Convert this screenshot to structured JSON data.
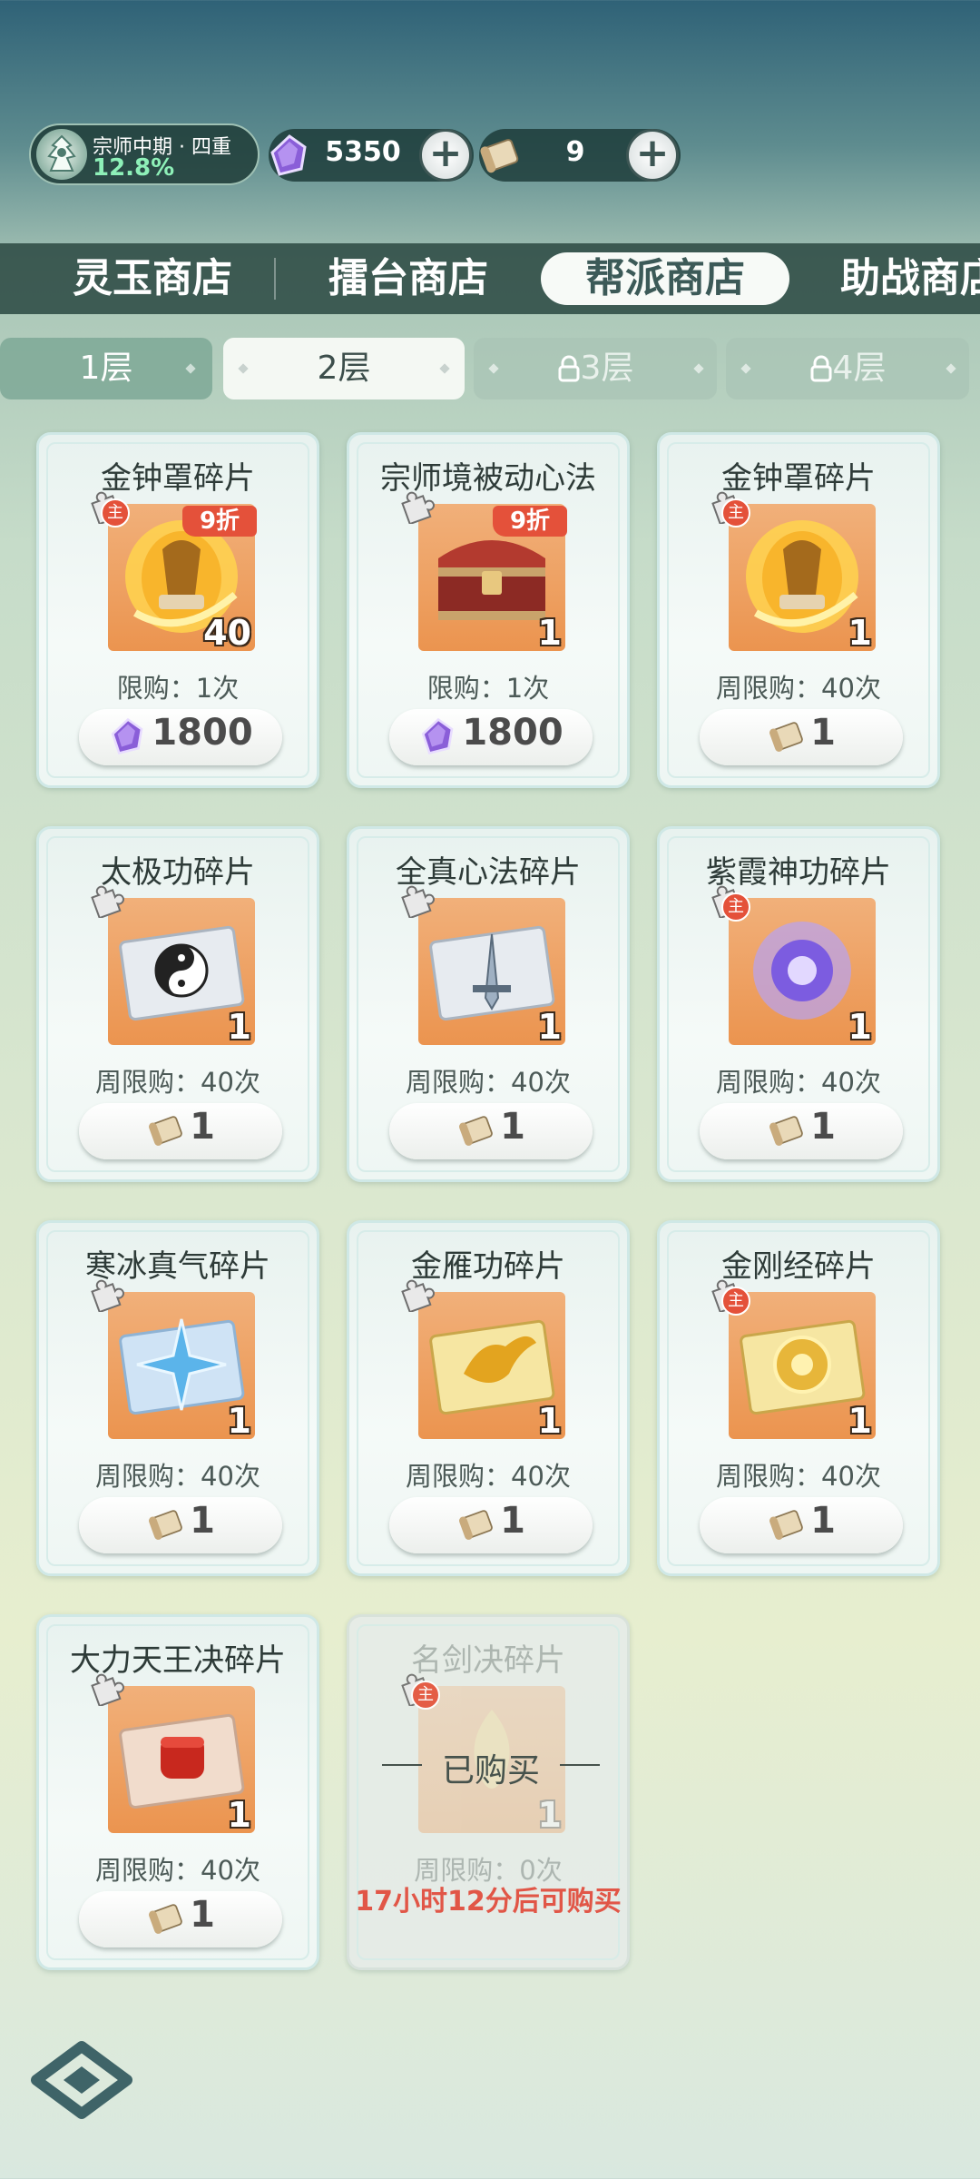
{
  "header": {
    "rank_title": "宗师中期 · 四重",
    "rank_progress": "12.8%",
    "jade_amount": "5350",
    "token_amount": "9",
    "plus_label": "+"
  },
  "shop_tabs": [
    {
      "label": "灵玉商店",
      "active": false
    },
    {
      "label": "擂台商店",
      "active": false
    },
    {
      "label": "帮派商店",
      "active": true
    },
    {
      "label": "助战商店",
      "active": false
    }
  ],
  "floors": [
    {
      "label": "1层",
      "state": "normal"
    },
    {
      "label": "2层",
      "state": "active"
    },
    {
      "label": "3层",
      "state": "locked"
    },
    {
      "label": "4层",
      "state": "locked"
    }
  ],
  "items": [
    {
      "name": "金钟罩碎片",
      "qty": "40",
      "discount": "9折",
      "main": true,
      "limit": "限购：1次",
      "price": "1800",
      "currency": "jade",
      "icon": "golden-bell-icon"
    },
    {
      "name": "宗师境被动心法",
      "qty": "1",
      "discount": "9折",
      "main": false,
      "limit": "限购：1次",
      "price": "1800",
      "currency": "jade",
      "icon": "treasure-chest-icon"
    },
    {
      "name": "金钟罩碎片",
      "qty": "1",
      "discount": "",
      "main": true,
      "limit": "周限购：40次",
      "price": "1",
      "currency": "scroll",
      "icon": "golden-bell-icon"
    },
    {
      "name": "太极功碎片",
      "qty": "1",
      "discount": "",
      "main": false,
      "limit": "周限购：40次",
      "price": "1",
      "currency": "scroll",
      "icon": "taiji-scroll-icon"
    },
    {
      "name": "全真心法碎片",
      "qty": "1",
      "discount": "",
      "main": false,
      "limit": "周限购：40次",
      "price": "1",
      "currency": "scroll",
      "icon": "sword-scroll-icon"
    },
    {
      "name": "紫霞神功碎片",
      "qty": "1",
      "discount": "",
      "main": true,
      "limit": "周限购：40次",
      "price": "1",
      "currency": "scroll",
      "icon": "purple-orb-icon"
    },
    {
      "name": "寒冰真气碎片",
      "qty": "1",
      "discount": "",
      "main": false,
      "limit": "周限购：40次",
      "price": "1",
      "currency": "scroll",
      "icon": "ice-star-scroll-icon"
    },
    {
      "name": "金雁功碎片",
      "qty": "1",
      "discount": "",
      "main": false,
      "limit": "周限购：40次",
      "price": "1",
      "currency": "scroll",
      "icon": "golden-bird-scroll-icon"
    },
    {
      "name": "金刚经碎片",
      "qty": "1",
      "discount": "",
      "main": true,
      "limit": "周限购：40次",
      "price": "1",
      "currency": "scroll",
      "icon": "golden-emblem-scroll-icon"
    },
    {
      "name": "大力天王决碎片",
      "qty": "1",
      "discount": "",
      "main": false,
      "limit": "周限购：40次",
      "price": "1",
      "currency": "scroll",
      "icon": "red-fist-scroll-icon"
    },
    {
      "name": "名剑决碎片",
      "qty": "1",
      "discount": "",
      "main": true,
      "limit": "周限购：0次",
      "price": "",
      "currency": "",
      "icon": "sword-flame-icon",
      "sold": true,
      "sold_label": "已购买",
      "retry_text": "17小时12分后可购买"
    }
  ],
  "main_badge": "主",
  "colors": {
    "accent_red": "#e4513a",
    "tab_bg": "#2d4b44",
    "progress_green": "#8ef0b8"
  }
}
